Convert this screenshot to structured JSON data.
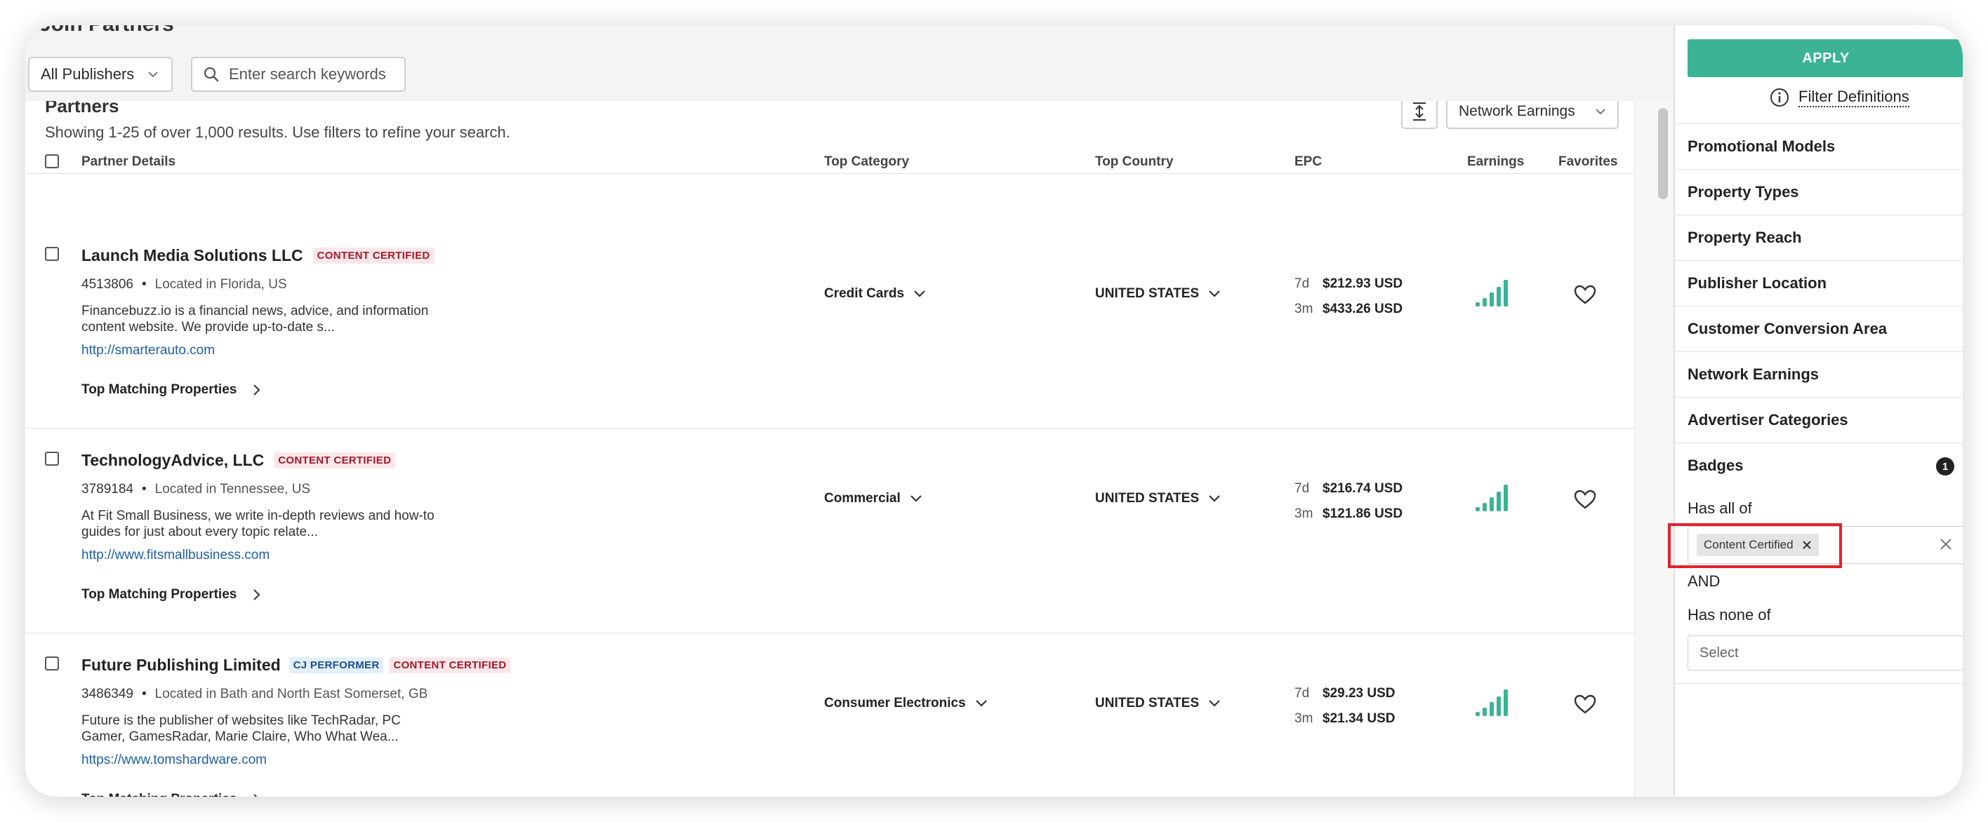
{
  "app": {
    "title": "Join Partners"
  },
  "toolbar": {
    "publisher_select": "All Publishers",
    "search_placeholder": "Enter search keywords"
  },
  "main": {
    "section_title": "Partners",
    "results_text": "Showing 1-25 of over 1,000 results. Use filters to refine your search.",
    "sort_select": "Network Earnings",
    "columns": [
      "Partner Details",
      "Top Category",
      "Top Country",
      "EPC",
      "Earnings",
      "Favorites"
    ],
    "top_matching_label": "Top Matching Properties",
    "rows": [
      {
        "name": "Launch Media Solutions LLC",
        "badges": [
          "CONTENT CERTIFIED"
        ],
        "id": "4513806",
        "location": "Located in Florida, US",
        "description": "Financebuzz.io is a financial news, advice, and information content website. We provide up-to-date s...",
        "url": "http://smarterauto.com",
        "category": "Credit Cards",
        "country": "UNITED STATES",
        "epc_7d_label": "7d",
        "epc_7d": "$212.93 USD",
        "epc_3m_label": "3m",
        "epc_3m": "$433.26 USD",
        "earnings_level": 5
      },
      {
        "name": "TechnologyAdvice, LLC",
        "badges": [
          "CONTENT CERTIFIED"
        ],
        "id": "3789184",
        "location": "Located in Tennessee, US",
        "description": "At Fit Small Business, we write in-depth reviews and how-to guides for just about every topic relate...",
        "url": "http://www.fitsmallbusiness.com",
        "category": "Commercial",
        "country": "UNITED STATES",
        "epc_7d_label": "7d",
        "epc_7d": "$216.74 USD",
        "epc_3m_label": "3m",
        "epc_3m": "$121.86 USD",
        "earnings_level": 5
      },
      {
        "name": "Future Publishing Limited",
        "badges": [
          "CJ PERFORMER",
          "CONTENT CERTIFIED"
        ],
        "id": "3486349",
        "location": "Located in Bath and North East Somerset, GB",
        "description": "Future is the publisher of websites like TechRadar, PC Gamer, GamesRadar, Marie Claire, Who What Wea...",
        "url": "https://www.tomshardware.com",
        "category": "Consumer Electronics",
        "country": "UNITED STATES",
        "epc_7d_label": "7d",
        "epc_7d": "$29.23 USD",
        "epc_3m_label": "3m",
        "epc_3m": "$21.34 USD",
        "earnings_level": 5
      }
    ]
  },
  "panel": {
    "apply_label": "APPLY",
    "filter_definitions": "Filter Definitions",
    "filters": [
      "Promotional Models",
      "Property Types",
      "Property Reach",
      "Publisher Location",
      "Customer Conversion Area",
      "Network Earnings",
      "Advertiser Categories"
    ],
    "badges_label": "Badges",
    "badges_count": "1",
    "has_all_of": "Has all of",
    "selected_chip": "Content Certified",
    "and_label": "AND",
    "has_none_of": "Has none of",
    "select_placeholder": "Select"
  },
  "colors": {
    "accent": "#3bb394",
    "badge_content_bg": "#fbe7e9",
    "badge_content_fg": "#a3182b",
    "badge_performer_bg": "#e3effa",
    "badge_performer_fg": "#1b4f8a",
    "link": "#1f5fa8",
    "highlight": "#e0232e"
  }
}
